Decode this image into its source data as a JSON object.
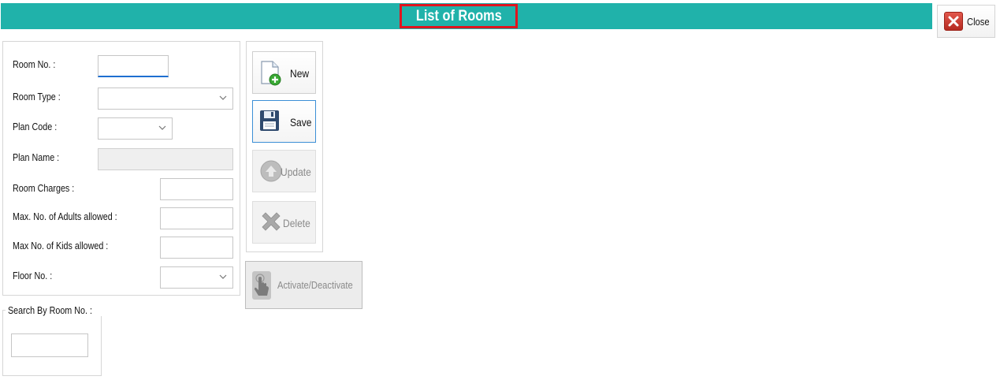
{
  "header": {
    "title": "List of Rooms",
    "close_label": "Close"
  },
  "form": {
    "room_no_label": "Room No. :",
    "room_type_label": "Room Type :",
    "plan_code_label": "Plan Code :",
    "plan_name_label": "Plan Name :",
    "room_charges_label": "Room Charges :",
    "max_adults_label": "Max. No. of Adults allowed :",
    "max_kids_label": "Max No. of Kids allowed :",
    "floor_no_label": "Floor No. :",
    "room_no_value": "",
    "room_type_value": "",
    "plan_code_value": "",
    "plan_name_value": "",
    "room_charges_value": "",
    "max_adults_value": "",
    "max_kids_value": "",
    "floor_no_value": ""
  },
  "actions": {
    "new_label": "New",
    "save_label": "Save",
    "update_label": "Update",
    "delete_label": "Delete",
    "activate_label": "Activate/Deactivate"
  },
  "search": {
    "legend": "Search By Room No. :",
    "value": ""
  },
  "colors": {
    "header_bg": "#20b2aa",
    "title_border": "#e0141e",
    "focus_underline": "#1e6fd0"
  },
  "icons": {
    "close": "close-x-icon",
    "new": "new-document-icon",
    "save": "floppy-disk-icon",
    "update": "up-arrow-circle-icon",
    "delete": "delete-x-icon",
    "activate": "hand-pointer-icon"
  }
}
